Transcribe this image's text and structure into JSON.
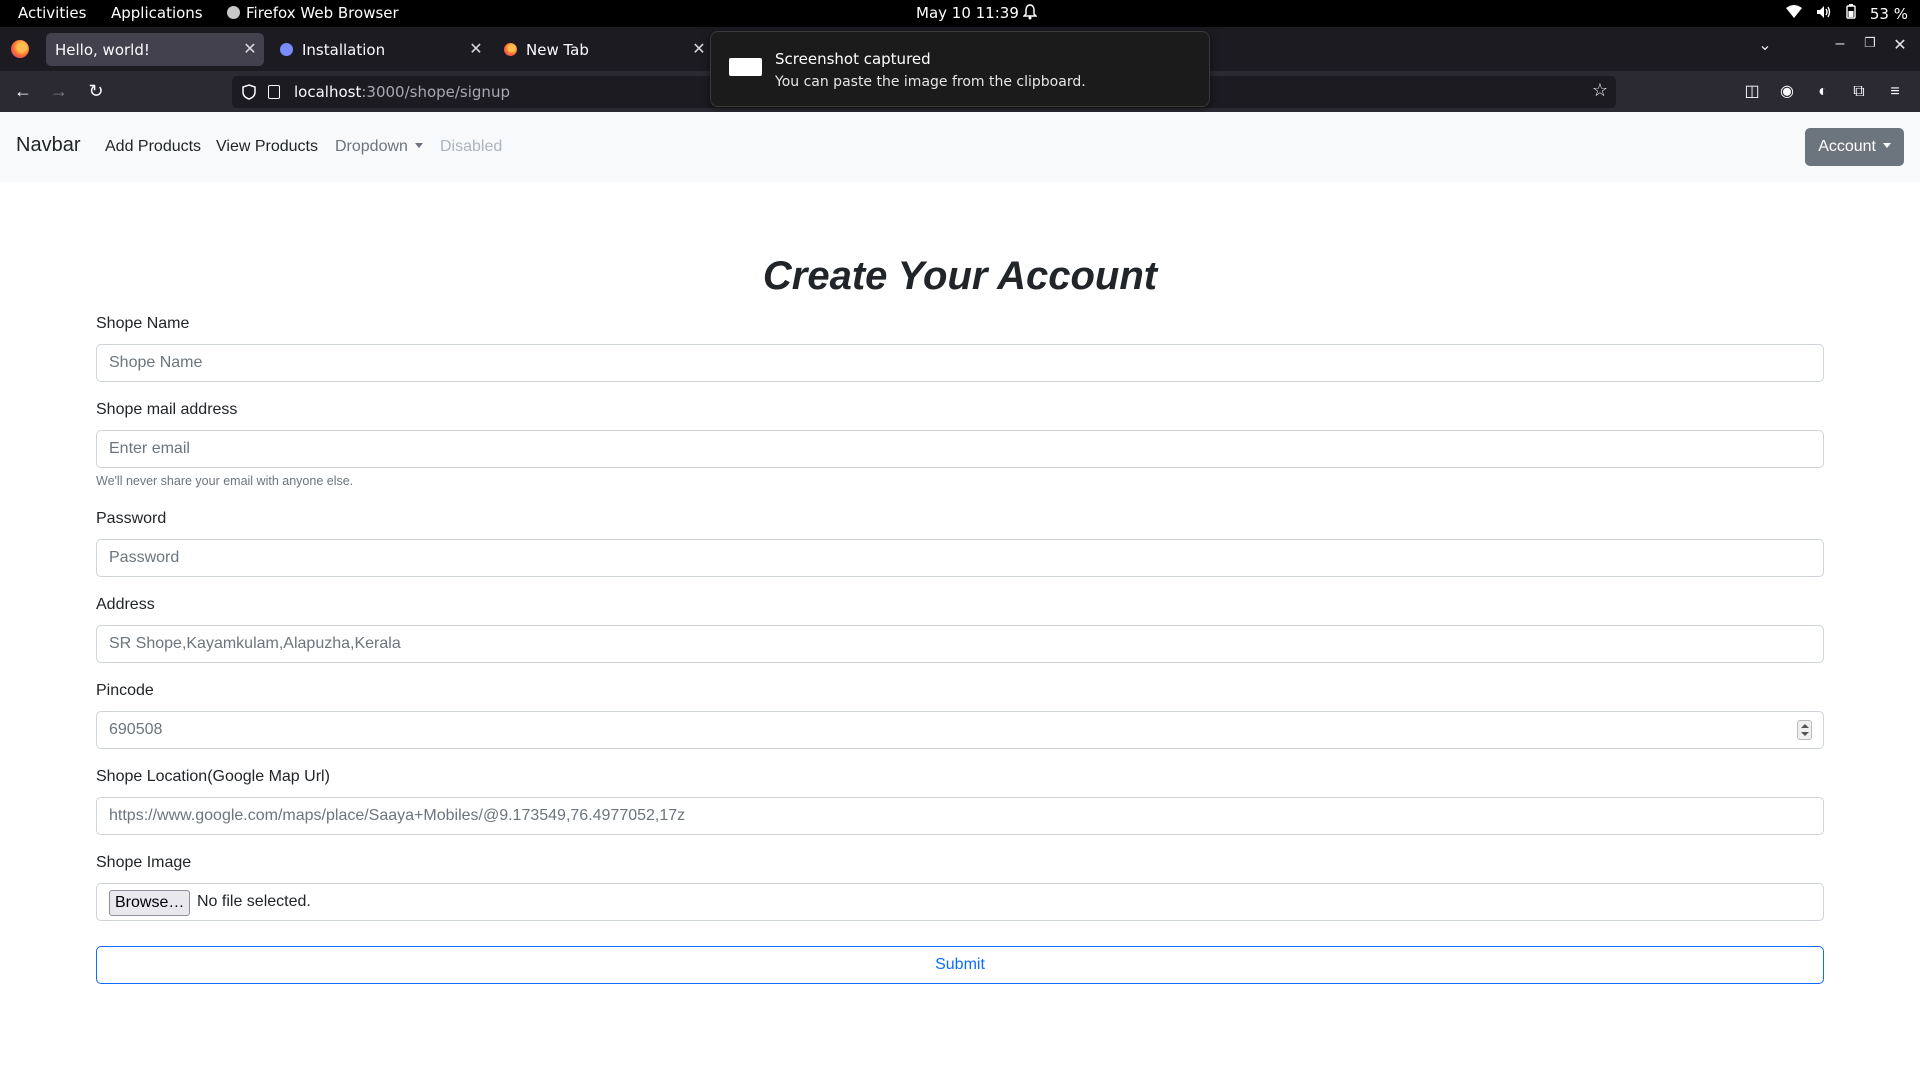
{
  "gnome": {
    "activities": "Activities",
    "applications": "Applications",
    "app_name": "Firefox Web Browser",
    "clock": "May 10  11:39",
    "battery": "53 %"
  },
  "tabs": [
    {
      "label": "Hello, world!",
      "favicon": "react-icon",
      "active": true
    },
    {
      "label": "Installation",
      "favicon": "globe-icon",
      "active": false
    },
    {
      "label": "New Tab",
      "favicon": "firefox-icon",
      "active": false
    }
  ],
  "urlbar": {
    "host": "localhost",
    "path": ":3000/shope/signup"
  },
  "notification": {
    "title": "Screenshot captured",
    "body": "You can paste the image from the clipboard."
  },
  "site_nav": {
    "brand": "Navbar",
    "links": [
      "Add Products",
      "View Products",
      "Dropdown",
      "Disabled"
    ],
    "account_button": "Account"
  },
  "form": {
    "title": "Create Your Account",
    "shop_name": {
      "label": "Shope Name",
      "placeholder": "Shope Name"
    },
    "email": {
      "label": "Shope mail address",
      "placeholder": "Enter email",
      "help": "We'll never share your email with anyone else."
    },
    "password": {
      "label": "Password",
      "placeholder": "Password"
    },
    "address": {
      "label": "Address",
      "placeholder": "SR Shope,Kayamkulam,Alapuzha,Kerala"
    },
    "pincode": {
      "label": "Pincode",
      "placeholder": "690508"
    },
    "location": {
      "label": "Shope Location(Google Map Url)",
      "placeholder": "https://www.google.com/maps/place/Saaya+Mobiles/@9.173549,76.4977052,17z"
    },
    "image": {
      "label": "Shope Image",
      "browse": "Browse…",
      "status": "No file selected."
    },
    "submit": "Submit"
  },
  "colors": {
    "primary": "#0d6efd",
    "secondary": "#6c757d",
    "navbar_bg": "#f8f9fa"
  }
}
